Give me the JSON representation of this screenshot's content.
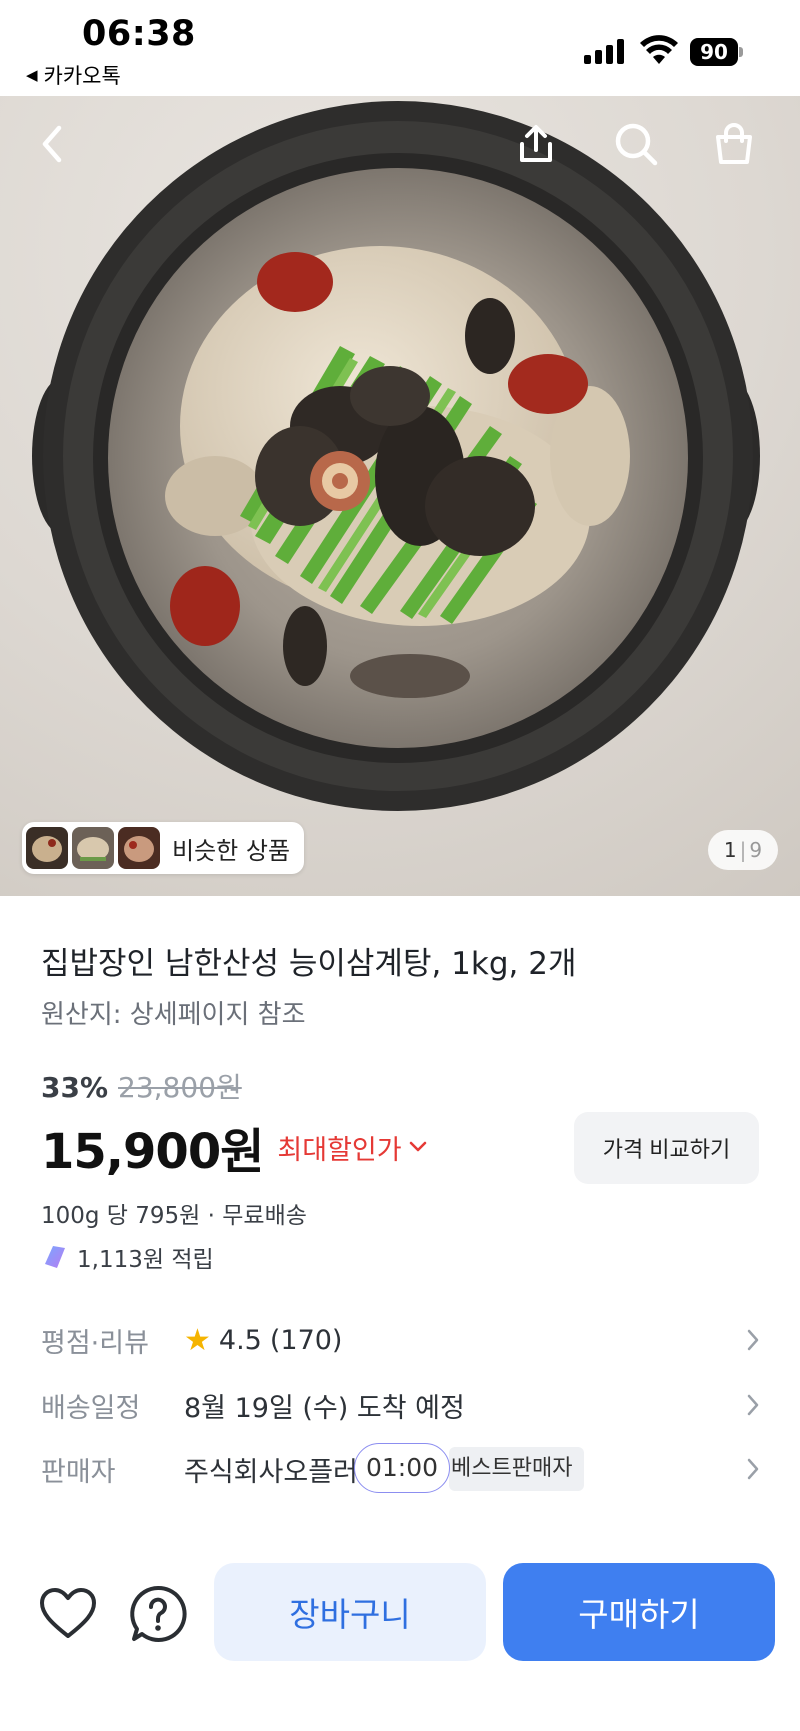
{
  "status_bar": {
    "time": "06:38",
    "back_app": "카카오톡",
    "battery": "90"
  },
  "hero": {
    "similar_label": "비슷한 상품",
    "pager_current": "1",
    "pager_total": "9",
    "icons": [
      "back-icon",
      "share-icon",
      "search-icon",
      "shopping-bag-icon"
    ]
  },
  "product": {
    "title": "집밥장인 남한산성 능이삼계탕, 1kg, 2개",
    "origin": "원산지: 상세페이지 참조",
    "discount_percent": "33%",
    "original_price": "23,800원",
    "price": "15,900원",
    "max_discount_label": "최대할인가",
    "compare_button": "가격 비교하기",
    "per_unit": "100g 당 795원 · 무료배송",
    "points": "1,113원 적립"
  },
  "info_rows": {
    "rating_label": "평점·리뷰",
    "rating_value": "4.5",
    "rating_count": "(170)",
    "delivery_label": "배송일정",
    "delivery_value": "8월 19일 (수) 도착 예정",
    "seller_label": "판매자",
    "seller_value": "주식회사오플러",
    "timer": "01:00",
    "best_seller_badge": "베스트판매자"
  },
  "bottom_bar": {
    "cart_button": "장바구니",
    "buy_button": "구매하기"
  },
  "colors": {
    "accent_blue": "#3f7ff0",
    "cart_bg": "#eaf1fd",
    "discount_red": "#e53935",
    "star": "#f5b400"
  }
}
